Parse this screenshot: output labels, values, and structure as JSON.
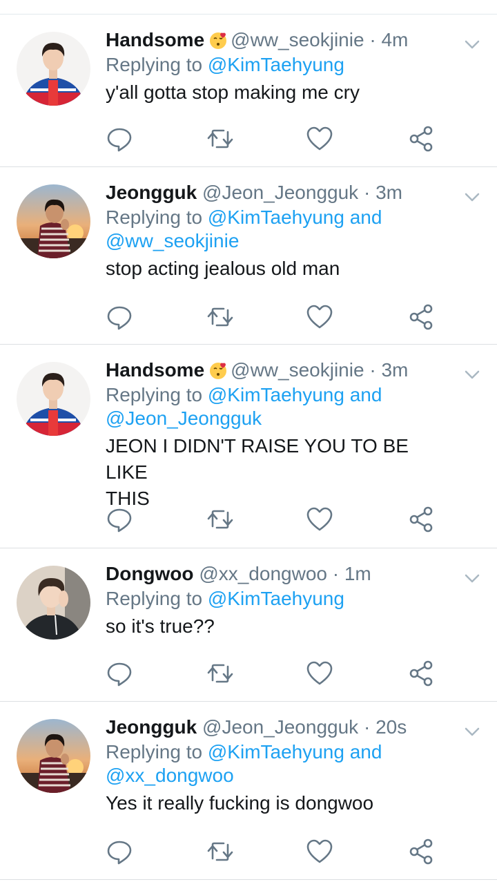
{
  "colors": {
    "link": "#1da1f2",
    "secondary_text": "#657786",
    "primary_text": "#14171a",
    "divider": "#e1e8ed"
  },
  "tweets": [
    {
      "name": "Handsome",
      "has_emoji": true,
      "emoji_icon": "kissing-face-heart-emoji",
      "handle": "@ww_seokjinie",
      "time": "4m",
      "replying_prefix": "Replying to ",
      "mentions": [
        "@KimTaehyung"
      ],
      "text": "y'all gotta stop making me cry",
      "avatar_icon": "avatar-red-hoodie"
    },
    {
      "name": "Jeongguk",
      "has_emoji": false,
      "handle": "@Jeon_Jeongguk",
      "time": "3m",
      "replying_prefix": "Replying to ",
      "mentions": [
        "@KimTaehyung",
        "@ww_seokjinie"
      ],
      "mention_joiner": " and",
      "text": "stop acting jealous old man",
      "avatar_icon": "avatar-sunset-stripes"
    },
    {
      "name": "Handsome",
      "has_emoji": true,
      "emoji_icon": "kissing-face-heart-emoji",
      "handle": "@ww_seokjinie",
      "time": "3m",
      "replying_prefix": "Replying to ",
      "mentions": [
        "@KimTaehyung",
        "@Jeon_Jeongguk"
      ],
      "mention_joiner": " and",
      "text_lines": [
        "JEON I DIDN'T RAISE YOU TO BE LIKE",
        "THIS"
      ],
      "avatar_icon": "avatar-red-hoodie"
    },
    {
      "name": "Dongwoo",
      "has_emoji": false,
      "handle": "@xx_dongwoo",
      "time": "1m",
      "replying_prefix": "Replying to ",
      "mentions": [
        "@KimTaehyung"
      ],
      "text": "so it's true??",
      "avatar_icon": "avatar-dark-jacket"
    },
    {
      "name": "Jeongguk",
      "has_emoji": false,
      "handle": "@Jeon_Jeongguk",
      "time": "20s",
      "replying_prefix": "Replying to ",
      "mentions": [
        "@KimTaehyung",
        "@xx_dongwoo"
      ],
      "mention_joiner": " and",
      "text": "Yes it really fucking is dongwoo",
      "avatar_icon": "avatar-sunset-stripes"
    }
  ],
  "separator": " · ",
  "action_icons": [
    "reply-icon",
    "retweet-icon",
    "like-icon",
    "share-icon"
  ]
}
